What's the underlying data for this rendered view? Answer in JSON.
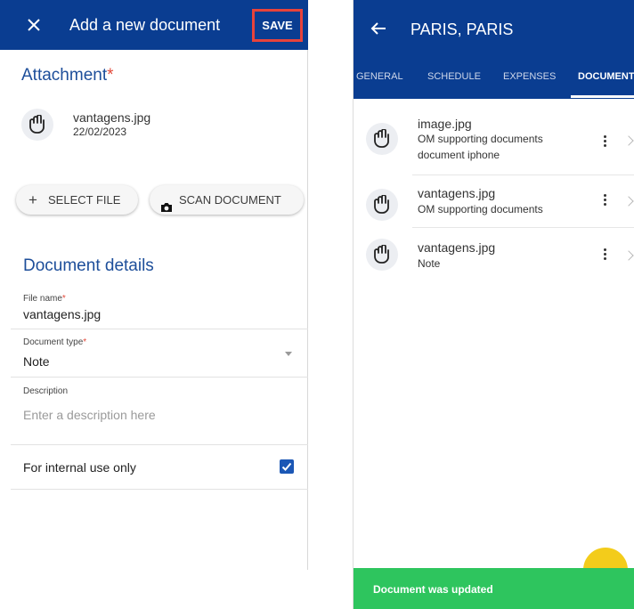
{
  "left_panel": {
    "header": {
      "title": "Add a new document",
      "save_label": "SAVE"
    },
    "attachment": {
      "section_title": "Attachment",
      "required_mark": "*",
      "file_name": "vantagens.jpg",
      "file_date": "22/02/2023"
    },
    "buttons": {
      "select_file": "SELECT FILE",
      "scan_document": "SCAN DOCUMENT"
    },
    "details": {
      "section_title": "Document details",
      "file_name_label": "File name",
      "file_name_value": "vantagens.jpg",
      "doc_type_label": "Document type",
      "doc_type_value": "Note",
      "description_label": "Description",
      "description_placeholder": "Enter a description here",
      "internal_label": "For internal use only",
      "internal_checked": true,
      "required_mark": "*"
    }
  },
  "right_panel": {
    "header": {
      "title": "PARIS, PARIS"
    },
    "tabs": [
      {
        "label": "GENERAL",
        "active": false
      },
      {
        "label": "SCHEDULE",
        "active": false
      },
      {
        "label": "EXPENSES",
        "active": false
      },
      {
        "label": "DOCUMENTS",
        "active": true
      }
    ],
    "documents": [
      {
        "name": "image.jpg",
        "subtitle": "OM supporting documents",
        "note": "document iphone"
      },
      {
        "name": "vantagens.jpg",
        "subtitle": "OM supporting documents"
      },
      {
        "name": "vantagens.jpg",
        "subtitle": "Note"
      }
    ],
    "toast": {
      "message": "Document was updated"
    }
  },
  "colors": {
    "header_blue": "#0a3d91",
    "save_highlight": "#e8433b",
    "section_title": "#1d4e9a",
    "required": "#e24a3b",
    "toast_green": "#2ec55e",
    "fab_yellow": "#f3cc1b"
  },
  "icons": [
    "close-icon",
    "attachment-icon",
    "plus-icon",
    "camera-icon",
    "chevron-down-icon",
    "checkbox-checked-icon",
    "back-arrow-icon",
    "more-vert-icon",
    "chevron-right-icon"
  ]
}
